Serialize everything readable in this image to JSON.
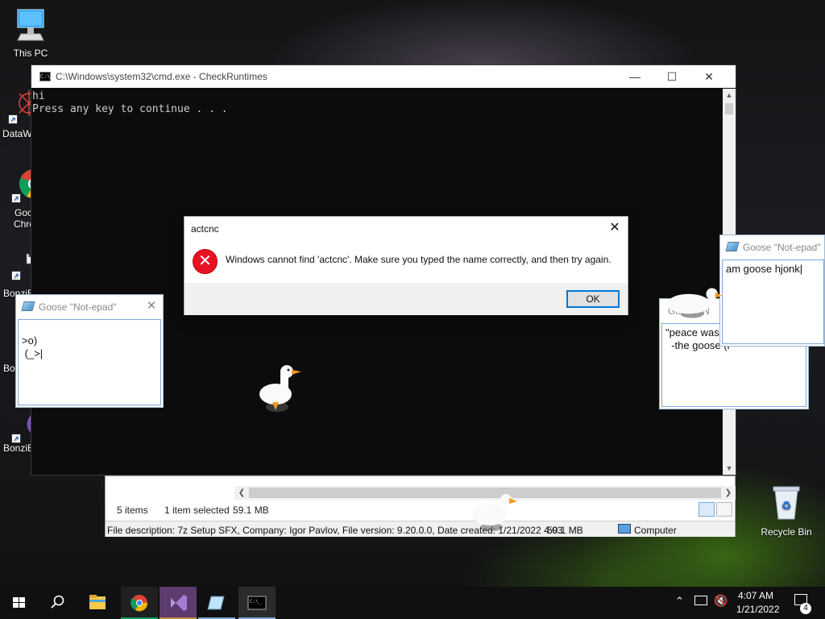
{
  "desktop": {
    "icons": [
      {
        "label": "This PC",
        "icon": "computer-icon"
      },
      {
        "label": "DataW",
        "icon": "datawiper-icon"
      },
      {
        "label": "Goo",
        "icon": "chrome-icon"
      },
      {
        "label": "Chro",
        "icon": "chrome-icon"
      },
      {
        "label": "BonziB",
        "icon": "bonzi-icon"
      },
      {
        "label": "Bo",
        "icon": "bonzi-icon"
      },
      {
        "label": "BonziB",
        "icon": "bonzi-icon"
      },
      {
        "label": "Recycle Bin",
        "icon": "recycle-bin-icon"
      }
    ]
  },
  "cmd": {
    "title": "C:\\Windows\\system32\\cmd.exe - CheckRuntimes",
    "lines": [
      "hi",
      "Press any key to continue . . ."
    ],
    "controls": {
      "minimize": "—",
      "maximize": "☐",
      "close": "✕"
    }
  },
  "dialog": {
    "title": "actcnc",
    "message": "Windows cannot find 'actcnc'. Make sure you typed the name correctly, and then try again.",
    "ok_label": "OK",
    "icon": "error-icon",
    "accent": "#0078d7"
  },
  "notepads": [
    {
      "title": "Goose \"Not-epad\"",
      "text": ">o)\n (_>|"
    },
    {
      "title": "Goose \"N",
      "text": "\"peace was\n  -the goose (i"
    },
    {
      "title": "Goose \"Not-epad\"",
      "text": "am goose hjonk|"
    }
  ],
  "explorer": {
    "items_count": "5 items",
    "selected": "1 item selected",
    "selected_size": "59.1 MB",
    "file_description": "File description: 7z Setup SFX, Company: Igor Pavlov, File version: 9.20.0.0, Date created: 1/21/2022 4:03",
    "size": "59.1 MB",
    "location": "Computer"
  },
  "taskbar": {
    "apps": [
      "start-icon",
      "search-icon",
      "file-explorer-icon",
      "chrome-icon",
      "visual-studio-icon",
      "notepad-icon",
      "cmd-icon"
    ],
    "time": "4:07 AM",
    "date": "1/21/2022",
    "notifications": "4"
  }
}
